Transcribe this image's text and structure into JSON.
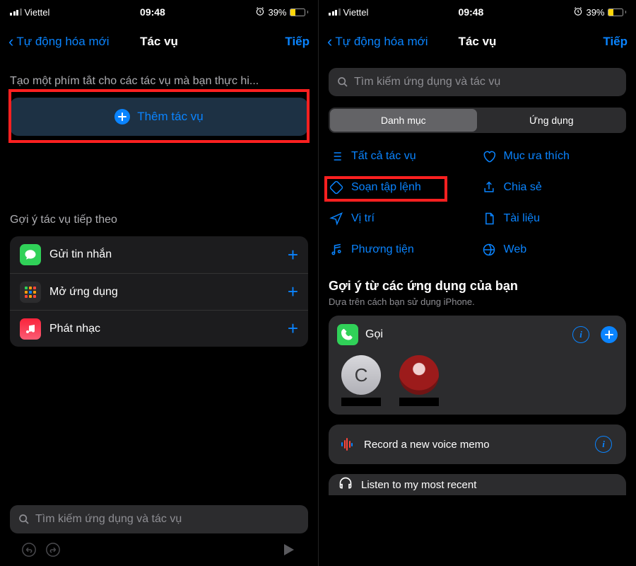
{
  "status": {
    "carrier": "Viettel",
    "time": "09:48",
    "battery_pct": "39%"
  },
  "nav": {
    "back": "Tự động hóa mới",
    "title": "Tác vụ",
    "next": "Tiếp"
  },
  "left": {
    "intro": "Tạo một phím tắt cho các tác vụ mà bạn thực hi...",
    "add_action": "Thêm tác vụ",
    "next_section": "Gợi ý tác vụ tiếp theo",
    "suggestions": [
      {
        "label": "Gửi tin nhắn",
        "iconClass": "green",
        "icon": "chat"
      },
      {
        "label": "Mở ứng dụng",
        "iconClass": "grid",
        "icon": "grid"
      },
      {
        "label": "Phát nhạc",
        "iconClass": "red",
        "icon": "music"
      }
    ],
    "search_placeholder": "Tìm kiếm ứng dụng và tác vụ"
  },
  "right": {
    "search_placeholder": "Tìm kiếm ứng dụng và tác vụ",
    "segments": [
      "Danh mục",
      "Ứng dụng"
    ],
    "categories": [
      {
        "label": "Tất cả tác vụ",
        "icon": "list"
      },
      {
        "label": "Mục ưa thích",
        "icon": "heart"
      },
      {
        "label": "Soạn tập lệnh",
        "icon": "script",
        "highlight": true
      },
      {
        "label": "Chia sẻ",
        "icon": "share"
      },
      {
        "label": "Vị trí",
        "icon": "location"
      },
      {
        "label": "Tài liệu",
        "icon": "doc"
      },
      {
        "label": "Phương tiện",
        "icon": "media"
      },
      {
        "label": "Web",
        "icon": "web"
      }
    ],
    "apps_heading": "Gợi ý từ các ứng dụng của bạn",
    "apps_sub": "Dựa trên cách bạn sử dụng iPhone.",
    "call_card": {
      "title": "Gọi",
      "contact_initial": "C"
    },
    "voice_memo": "Record a new voice memo",
    "cutoff": "Listen to my most recent"
  }
}
